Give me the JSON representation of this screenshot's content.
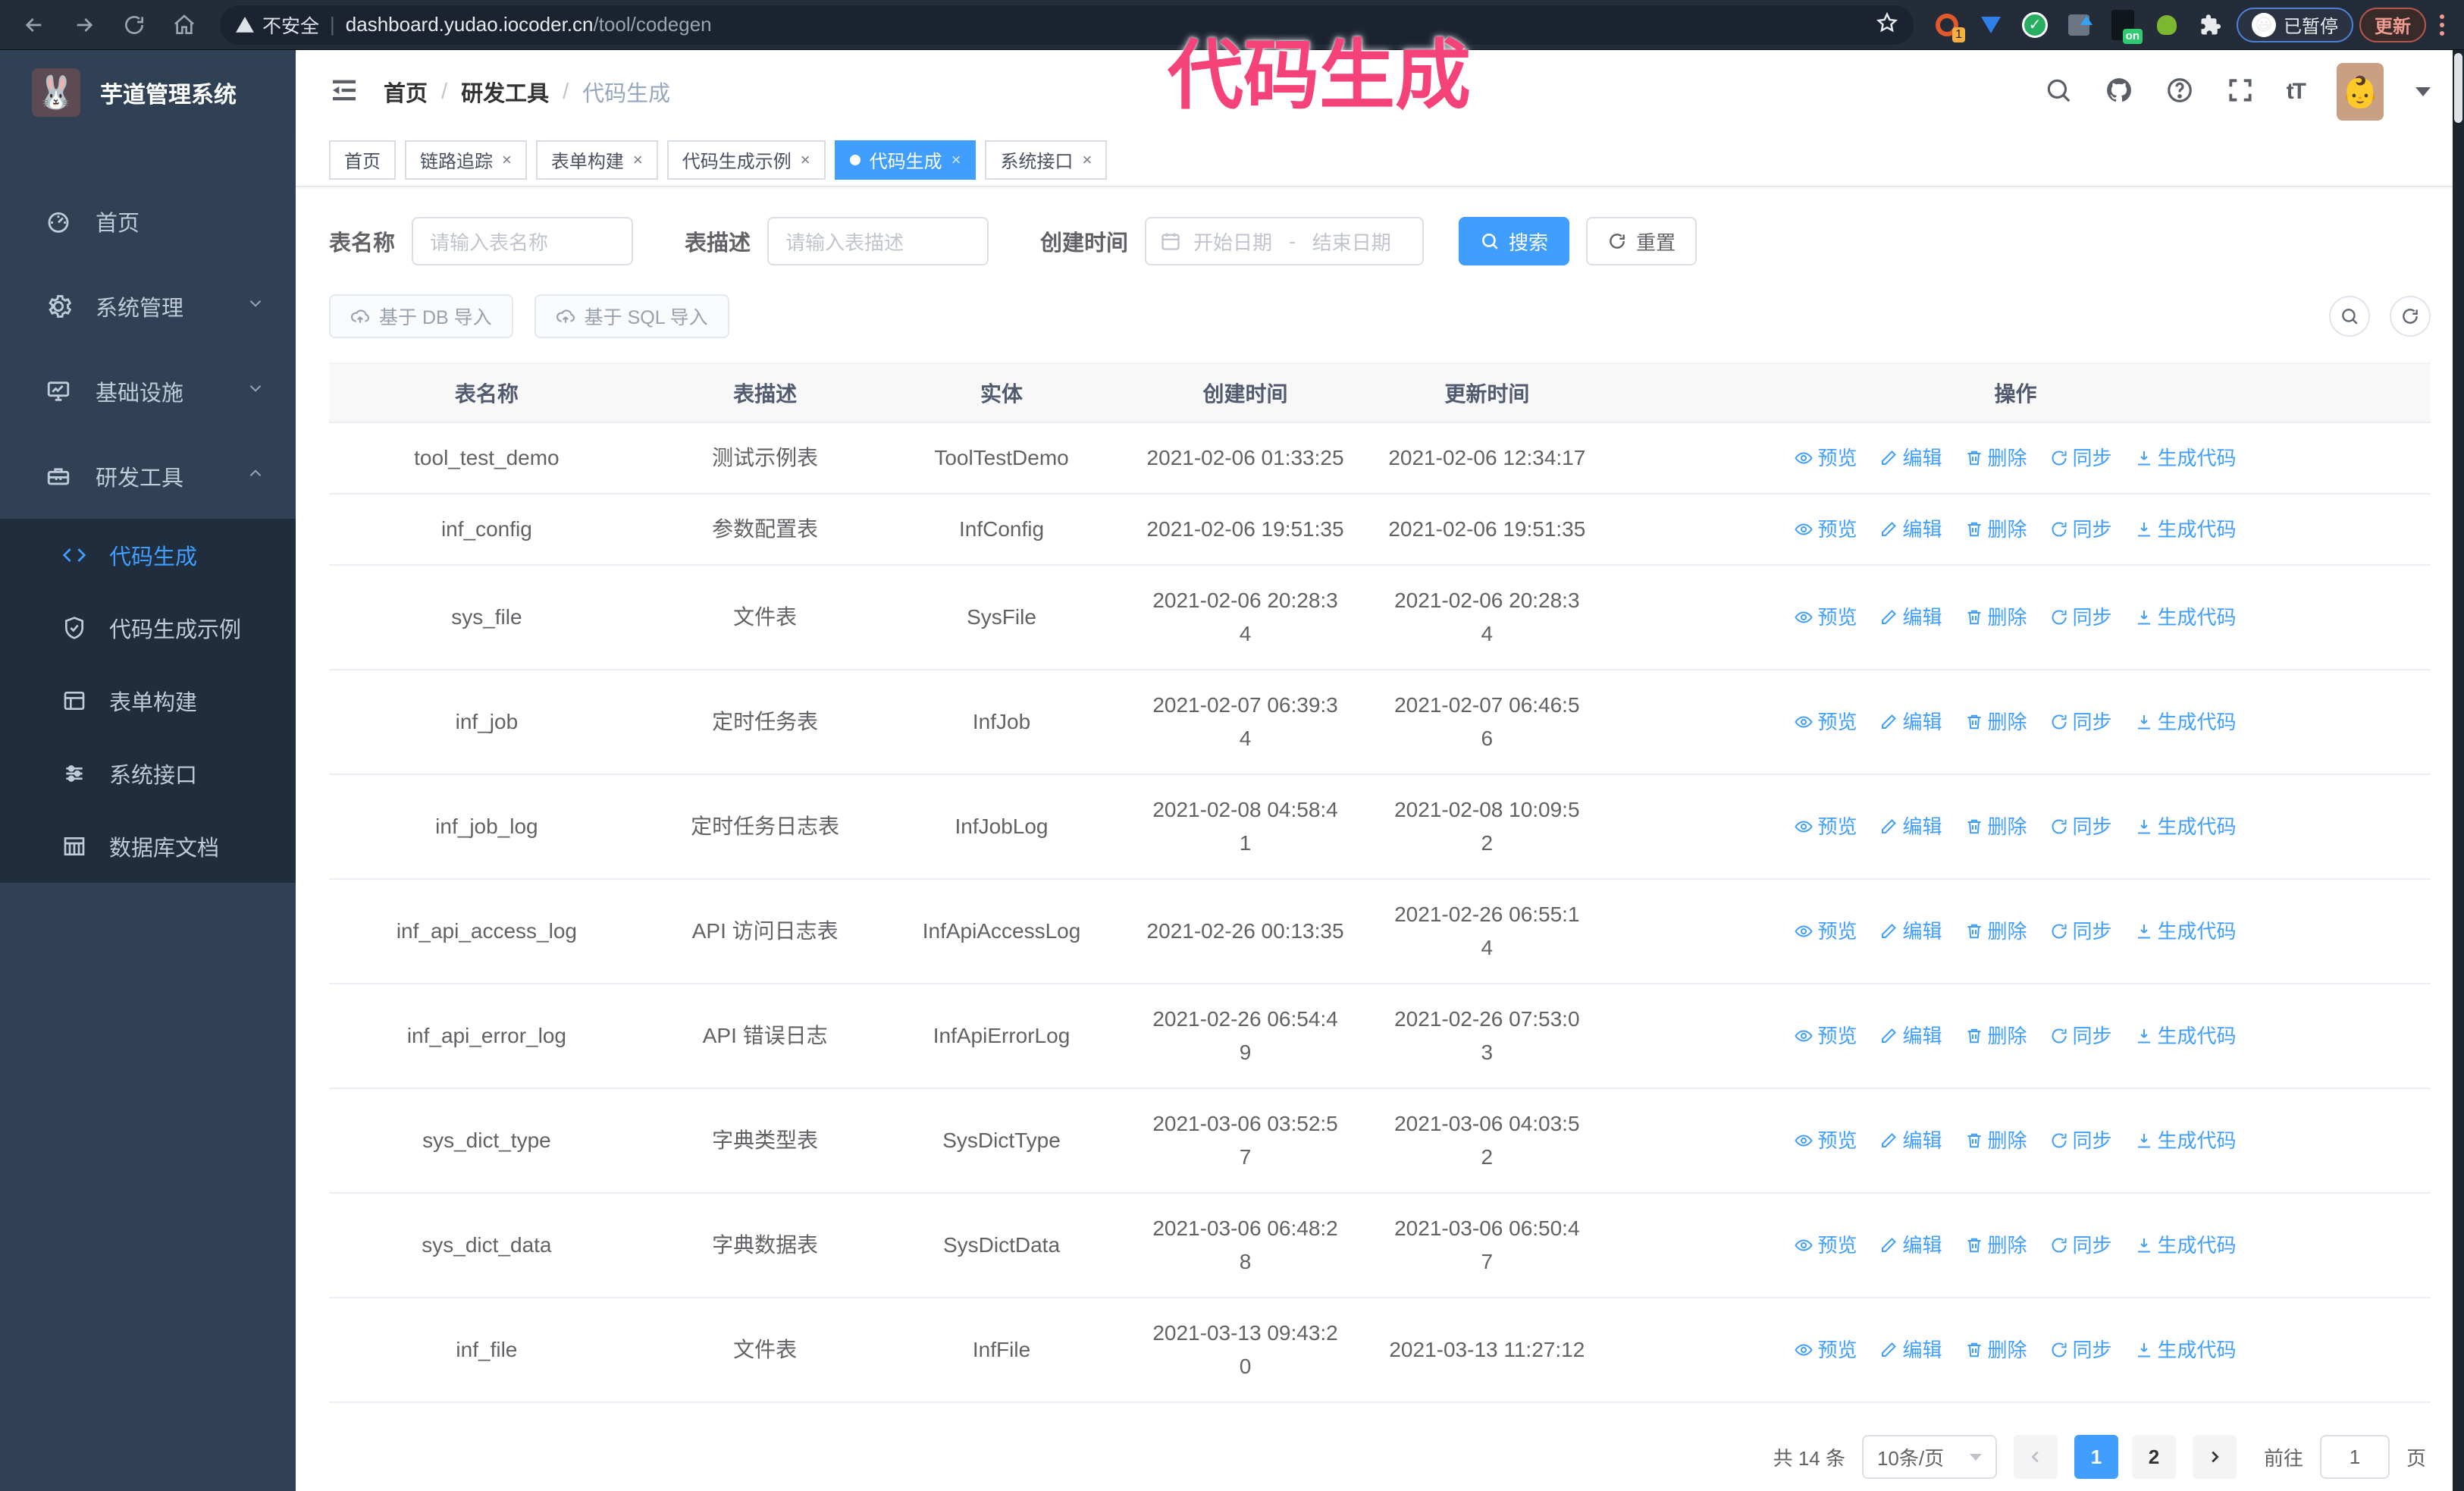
{
  "browser": {
    "security_label": "不安全",
    "url_host": "dashboard.yudao.iocoder.cn",
    "url_path": "/tool/codegen",
    "paused_badge": "已暂停",
    "update_button": "更新"
  },
  "annotation": {
    "text": "代码生成",
    "color": "#f5437a"
  },
  "sidebar": {
    "title": "芋道管理系统",
    "items": [
      {
        "label": "首页",
        "icon": "dashboard-icon",
        "expandable": false,
        "expanded": false
      },
      {
        "label": "系统管理",
        "icon": "gear-icon",
        "expandable": true,
        "expanded": false
      },
      {
        "label": "基础设施",
        "icon": "monitor-icon",
        "expandable": true,
        "expanded": false
      },
      {
        "label": "研发工具",
        "icon": "toolbox-icon",
        "expandable": true,
        "expanded": true
      }
    ],
    "submenu": [
      {
        "label": "代码生成",
        "icon": "code-icon",
        "active": true
      },
      {
        "label": "代码生成示例",
        "icon": "badge-check-icon",
        "active": false
      },
      {
        "label": "表单构建",
        "icon": "form-icon",
        "active": false
      },
      {
        "label": "系统接口",
        "icon": "sliders-icon",
        "active": false
      },
      {
        "label": "数据库文档",
        "icon": "db-grid-icon",
        "active": false
      }
    ]
  },
  "breadcrumb": {
    "separator": "/",
    "items": [
      "首页",
      "研发工具",
      "代码生成"
    ]
  },
  "tabs": [
    {
      "label": "首页",
      "closable": false,
      "active": false
    },
    {
      "label": "链路追踪",
      "closable": true,
      "active": false
    },
    {
      "label": "表单构建",
      "closable": true,
      "active": false
    },
    {
      "label": "代码生成示例",
      "closable": true,
      "active": false
    },
    {
      "label": "代码生成",
      "closable": true,
      "active": true
    },
    {
      "label": "系统接口",
      "closable": true,
      "active": false
    }
  ],
  "filters": {
    "name_label": "表名称",
    "name_placeholder": "请输入表名称",
    "desc_label": "表描述",
    "desc_placeholder": "请输入表描述",
    "time_label": "创建时间",
    "start_placeholder": "开始日期",
    "range_separator": "-",
    "end_placeholder": "结束日期",
    "search_button": "搜索",
    "reset_button": "重置"
  },
  "toolbar": {
    "import_db": "基于 DB 导入",
    "import_sql": "基于 SQL 导入"
  },
  "table": {
    "columns": [
      "表名称",
      "表描述",
      "实体",
      "创建时间",
      "更新时间",
      "操作"
    ],
    "actions": [
      {
        "label": "预览",
        "icon": "eye-icon"
      },
      {
        "label": "编辑",
        "icon": "edit-icon"
      },
      {
        "label": "删除",
        "icon": "trash-icon"
      },
      {
        "label": "同步",
        "icon": "sync-icon"
      },
      {
        "label": "生成代码",
        "icon": "download-icon"
      }
    ],
    "rows": [
      {
        "name": "tool_test_demo",
        "desc": "测试示例表",
        "entity": "ToolTestDemo",
        "create_time": "2021-02-06 01:33:25",
        "update_time": "2021-02-06 12:34:17"
      },
      {
        "name": "inf_config",
        "desc": "参数配置表",
        "entity": "InfConfig",
        "create_time": "2021-02-06 19:51:35",
        "update_time": "2021-02-06 19:51:35"
      },
      {
        "name": "sys_file",
        "desc": "文件表",
        "entity": "SysFile",
        "create_time": "2021-02-06 20:28:3\n4",
        "update_time": "2021-02-06 20:28:3\n4"
      },
      {
        "name": "inf_job",
        "desc": "定时任务表",
        "entity": "InfJob",
        "create_time": "2021-02-07 06:39:3\n4",
        "update_time": "2021-02-07 06:46:5\n6"
      },
      {
        "name": "inf_job_log",
        "desc": "定时任务日志表",
        "entity": "InfJobLog",
        "create_time": "2021-02-08 04:58:4\n1",
        "update_time": "2021-02-08 10:09:5\n2"
      },
      {
        "name": "inf_api_access_log",
        "desc": "API 访问日志表",
        "entity": "InfApiAccessLog",
        "create_time": "2021-02-26 00:13:35",
        "update_time": "2021-02-26 06:55:1\n4"
      },
      {
        "name": "inf_api_error_log",
        "desc": "API 错误日志",
        "entity": "InfApiErrorLog",
        "create_time": "2021-02-26 06:54:4\n9",
        "update_time": "2021-02-26 07:53:0\n3"
      },
      {
        "name": "sys_dict_type",
        "desc": "字典类型表",
        "entity": "SysDictType",
        "create_time": "2021-03-06 03:52:5\n7",
        "update_time": "2021-03-06 04:03:5\n2"
      },
      {
        "name": "sys_dict_data",
        "desc": "字典数据表",
        "entity": "SysDictData",
        "create_time": "2021-03-06 06:48:2\n8",
        "update_time": "2021-03-06 06:50:4\n7"
      },
      {
        "name": "inf_file",
        "desc": "文件表",
        "entity": "InfFile",
        "create_time": "2021-03-13 09:43:2\n0",
        "update_time": "2021-03-13 11:27:12"
      }
    ]
  },
  "pagination": {
    "total": "共 14 条",
    "page_size": "10条/页",
    "pages": [
      "1",
      "2"
    ],
    "active_page": "1",
    "goto_label": "前往",
    "goto_value": "1",
    "goto_suffix": "页"
  }
}
